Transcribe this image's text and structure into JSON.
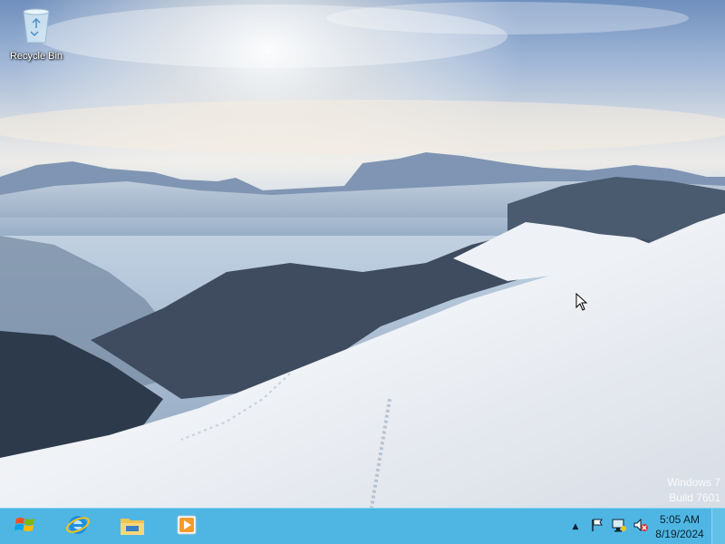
{
  "desktop": {
    "icons": [
      {
        "label": "Recycle Bin",
        "icon": "recycle-bin-icon"
      }
    ],
    "watermark": {
      "line1": "Windows 7",
      "line2": "Build 7601"
    },
    "wallpaper": "snowy-mountain-landscape"
  },
  "taskbar": {
    "background_color": "#4fb6e3",
    "start_icon": "windows-logo-icon",
    "pinned": [
      {
        "name": "Internet Explorer",
        "icon": "internet-explorer-icon"
      },
      {
        "name": "File Explorer",
        "icon": "folder-icon"
      },
      {
        "name": "Media Player",
        "icon": "media-player-icon"
      }
    ],
    "tray": {
      "chevron": "▲",
      "icons": [
        "flag-icon",
        "network-icon",
        "volume-muted-icon"
      ],
      "time": "5:05 AM",
      "date": "8/19/2024"
    }
  }
}
